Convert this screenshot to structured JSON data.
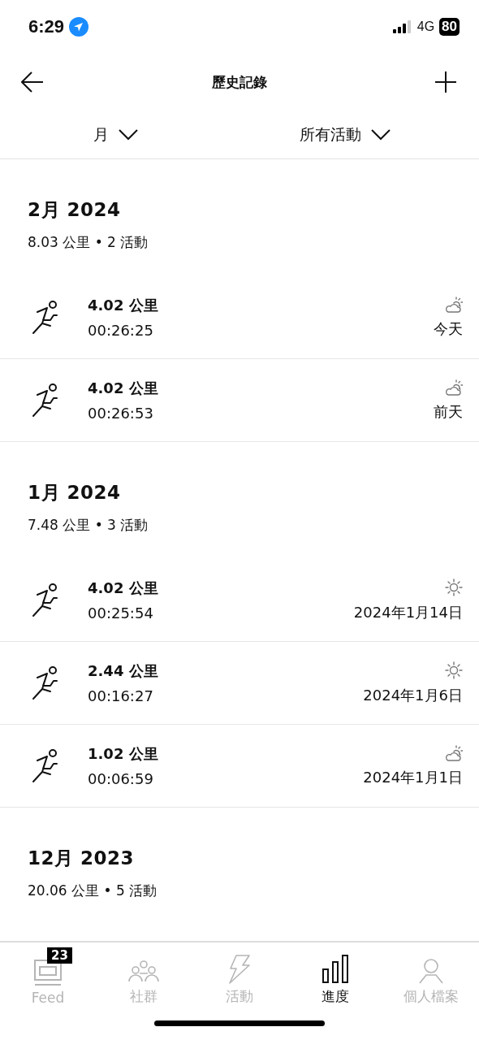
{
  "status_bar": {
    "time": "6:29",
    "network": "4G",
    "battery": "80"
  },
  "header": {
    "title": "歷史記錄"
  },
  "filters": [
    {
      "label": "月"
    },
    {
      "label": "所有活動"
    }
  ],
  "months": [
    {
      "title": "2月 2024",
      "summary": "8.03 公里 • 2 活動",
      "activities": [
        {
          "distance": "4.02 公里",
          "duration": "00:26:25",
          "date": "今天",
          "kind": "partly_cloudy"
        },
        {
          "distance": "4.02 公里",
          "duration": "00:26:53",
          "date": "前天",
          "kind": "partly_cloudy"
        }
      ]
    },
    {
      "title": "1月 2024",
      "summary": "7.48 公里 • 3 活動",
      "activities": [
        {
          "distance": "4.02 公里",
          "duration": "00:25:54",
          "date": "2024年1月14日",
          "kind": "sunny"
        },
        {
          "distance": "2.44 公里",
          "duration": "00:16:27",
          "date": "2024年1月6日",
          "kind": "sunny"
        },
        {
          "distance": "1.02 公里",
          "duration": "00:06:59",
          "date": "2024年1月1日",
          "kind": "partly_cloudy"
        }
      ]
    },
    {
      "title": "12月 2023",
      "summary": "20.06 公里 • 5 活動"
    }
  ],
  "tab_bar": [
    {
      "label": "Feed",
      "kind": "feed",
      "badge": "23",
      "selected": false
    },
    {
      "label": "社群",
      "kind": "community",
      "selected": false
    },
    {
      "label": "活動",
      "kind": "bolt",
      "selected": false
    },
    {
      "label": "進度",
      "kind": "progress",
      "selected": true
    },
    {
      "label": "個人檔案",
      "kind": "profile",
      "selected": false
    }
  ]
}
